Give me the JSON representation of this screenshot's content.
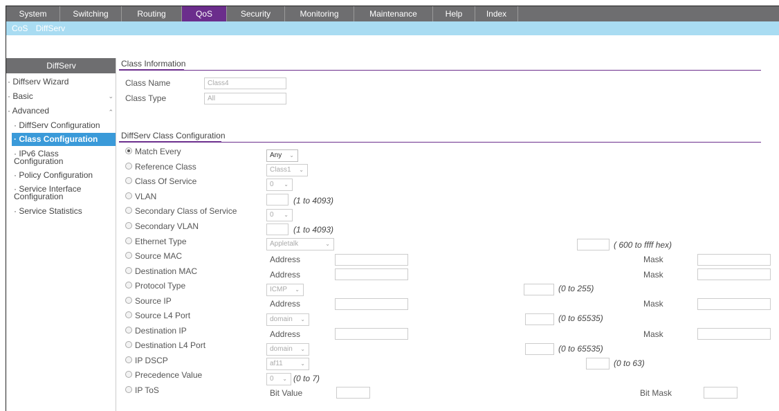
{
  "topnav": {
    "tabs": [
      {
        "label": "System"
      },
      {
        "label": "Switching"
      },
      {
        "label": "Routing"
      },
      {
        "label": "QoS"
      },
      {
        "label": "Security"
      },
      {
        "label": "Monitoring"
      },
      {
        "label": "Maintenance"
      },
      {
        "label": "Help"
      },
      {
        "label": "Index"
      }
    ]
  },
  "subnav": {
    "items": [
      {
        "label": "CoS"
      },
      {
        "label": "DiffServ"
      }
    ]
  },
  "sidebar": {
    "header": "DiffServ",
    "items": [
      {
        "label": "Diffserv Wizard"
      },
      {
        "label": "Basic"
      },
      {
        "label": "Advanced"
      }
    ],
    "subitems": [
      {
        "label": "DiffServ Configuration"
      },
      {
        "label": "Class Configuration"
      },
      {
        "label": "IPv6 Class Configuration"
      },
      {
        "label": "Policy Configuration"
      },
      {
        "label": "Service Interface Configuration"
      },
      {
        "label": "Service Statistics"
      }
    ]
  },
  "class_info": {
    "title": "Class Information",
    "name_label": "Class Name",
    "name_value": "Class4",
    "type_label": "Class Type",
    "type_value": "All"
  },
  "config": {
    "title": "DiffServ Class Configuration",
    "rows": [
      {
        "label": "Match Every",
        "select": "Any",
        "selected": true
      },
      {
        "label": "Reference Class",
        "select": "Class1"
      },
      {
        "label": "Class Of Service",
        "select": "0"
      },
      {
        "label": "VLAN",
        "range": "(1 to 4093)"
      },
      {
        "label": "Secondary Class of Service",
        "select": "0"
      },
      {
        "label": "Secondary VLAN",
        "range": "(1 to 4093)"
      },
      {
        "label": "Ethernet Type",
        "select": "Appletalk",
        "range": "( 600 to ffff hex)"
      },
      {
        "label": "Source MAC",
        "field1": "Address",
        "field2": "Mask"
      },
      {
        "label": "Destination MAC",
        "field1": "Address",
        "field2": "Mask"
      },
      {
        "label": "Protocol Type",
        "select": "ICMP",
        "range": "(0 to 255)"
      },
      {
        "label": "Source IP",
        "field1": "Address",
        "field2": "Mask"
      },
      {
        "label": "Source L4 Port",
        "select": "domain",
        "range": "(0 to 65535)"
      },
      {
        "label": "Destination IP",
        "field1": "Address",
        "field2": "Mask"
      },
      {
        "label": "Destination L4 Port",
        "select": "domain",
        "range": "(0 to 65535)"
      },
      {
        "label": "IP DSCP",
        "select": "af11",
        "range": "(0 to 63)"
      },
      {
        "label": "Precedence Value",
        "select": "0",
        "range": "(0 to 7)"
      },
      {
        "label": "IP ToS",
        "field1": "Bit Value",
        "field2": "Bit Mask"
      }
    ]
  },
  "colors": {
    "accent": "#6b2d8c",
    "nav": "#6e6e70",
    "subnav": "#a9dcf2",
    "active_side": "#3a9ad9"
  }
}
